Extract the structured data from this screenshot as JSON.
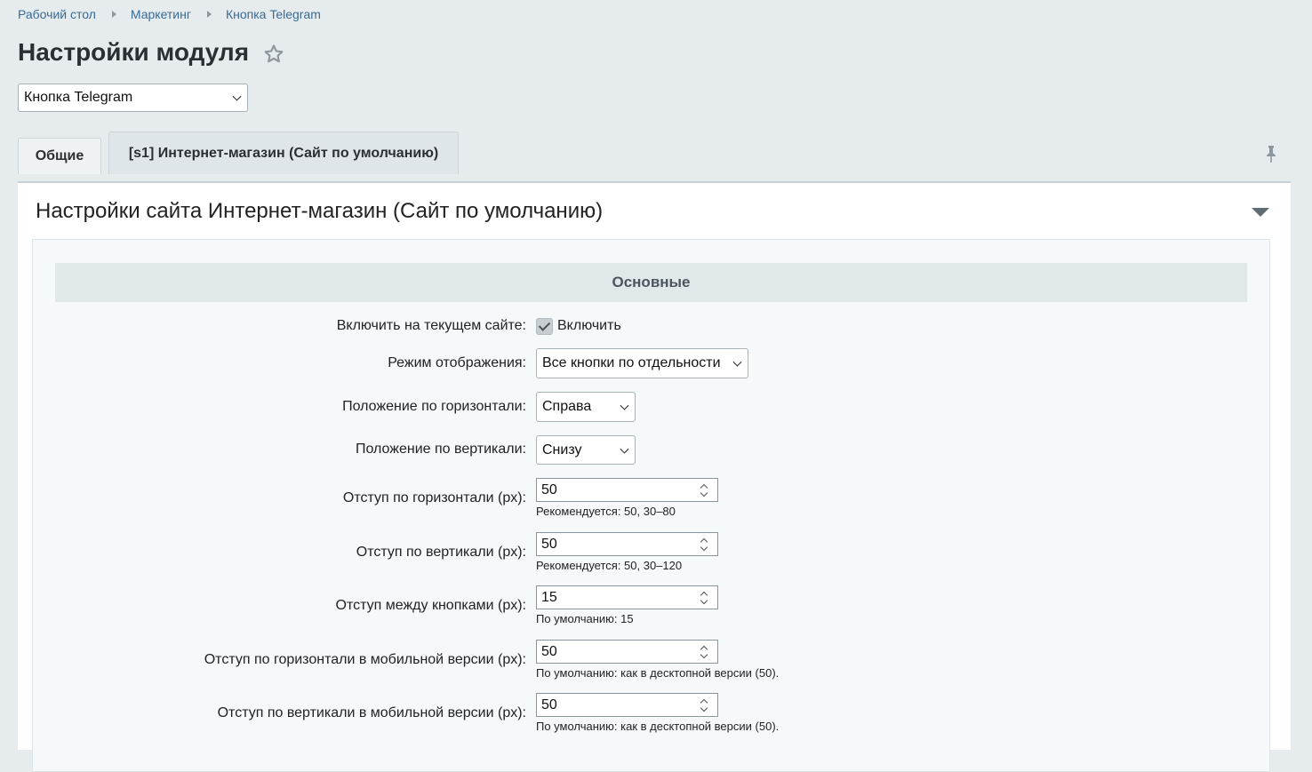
{
  "breadcrumb": [
    "Рабочий стол",
    "Маркетинг",
    "Кнопка Telegram"
  ],
  "page_title": "Настройки модуля",
  "module_select": {
    "value": "Кнопка Telegram"
  },
  "tabs": [
    {
      "label": "Общие",
      "active": false
    },
    {
      "label": "[s1] Интернет-магазин (Сайт по умолчанию)",
      "active": true
    }
  ],
  "panel": {
    "title": "Настройки сайта Интернет-магазин (Сайт по умолчанию)",
    "section_title": "Основные"
  },
  "fields": {
    "enable": {
      "label": "Включить на текущем сайте:",
      "checkbox_label": "Включить",
      "checked": true
    },
    "display_mode": {
      "label": "Режим отображения:",
      "value": "Все кнопки по отдельности"
    },
    "horiz_pos": {
      "label": "Положение по горизонтали:",
      "value": "Справа"
    },
    "vert_pos": {
      "label": "Положение по вертикали:",
      "value": "Снизу"
    },
    "offset_h": {
      "label": "Отступ по горизонтали (px):",
      "value": "50",
      "hint": "Рекомендуется: 50, 30–80"
    },
    "offset_v": {
      "label": "Отступ по вертикали (px):",
      "value": "50",
      "hint": "Рекомендуется: 50, 30–120"
    },
    "gap": {
      "label": "Отступ между кнопками (px):",
      "value": "15",
      "hint": "По умолчанию: 15"
    },
    "mobile_offset_h": {
      "label": "Отступ по горизонтали в мобильной версии (px):",
      "value": "50",
      "hint": "По умолчанию: как в десктопной версии (50)."
    },
    "mobile_offset_v": {
      "label": "Отступ по вертикали в мобильной версии (px):",
      "value": "50",
      "hint": "По умолчанию: как в десктопной версии (50)."
    }
  },
  "icons": [
    "star-icon",
    "pin-icon",
    "collapse-icon",
    "chevron-down-icon",
    "spinner-icon",
    "check-icon"
  ]
}
